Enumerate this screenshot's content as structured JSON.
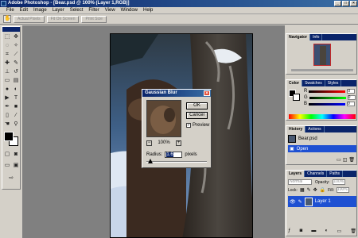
{
  "window": {
    "title": "Adobe Photoshop - [Bear.psd @ 100% (Layer 1,RGB)]",
    "controls": [
      "_",
      "□",
      "×"
    ]
  },
  "menu": [
    "File",
    "Edit",
    "Image",
    "Layer",
    "Select",
    "Filter",
    "View",
    "Window",
    "Help"
  ],
  "options": {
    "buttons": [
      "Actual Pixels",
      "Fit On Screen",
      "Print Size"
    ]
  },
  "dialog": {
    "title": "Gaussian Blur",
    "ok": "OK",
    "cancel": "Cancel",
    "preview_label": "Preview",
    "preview_checked": true,
    "zoom": "100%",
    "zoom_minus": "−",
    "zoom_plus": "+",
    "radius_label": "Radius:",
    "radius_value": "1.6",
    "radius_unit": "pixels",
    "radius_fraction": 0.06
  },
  "navigator": {
    "tabs": [
      "Navigator",
      "Info"
    ]
  },
  "color": {
    "tabs": [
      "Color",
      "Swatches",
      "Styles"
    ],
    "channels": [
      "R",
      "G",
      "B"
    ],
    "values": [
      "0",
      "0",
      "0"
    ]
  },
  "history": {
    "tabs": [
      "History",
      "Actions"
    ],
    "items": [
      {
        "label": "Bear.psd",
        "selected": false
      },
      {
        "label": "Open",
        "selected": true
      }
    ]
  },
  "layers": {
    "tabs": [
      "Layers",
      "Channels",
      "Paths"
    ],
    "mode": "Normal",
    "opacity_label": "Opacity:",
    "opacity": "100%",
    "lock_label": "Lock:",
    "fill_label": "Fill:",
    "fill": "100%",
    "items": [
      {
        "label": "Layer 1",
        "selected": true
      }
    ]
  },
  "colors": {
    "accent": "#0a246a",
    "selection": "#1e50d2"
  }
}
